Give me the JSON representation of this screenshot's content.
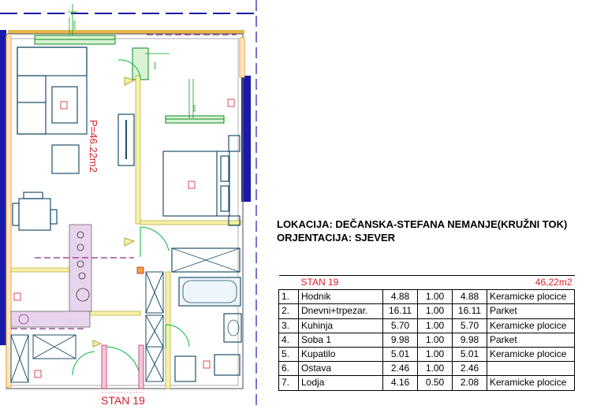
{
  "floor_plan": {
    "area_label": "P=46.22m2",
    "apartment_label": "STAN 19",
    "colors": {
      "wall": "#1a1aa8",
      "window_green": "#0a8a1a",
      "dims": "#0a9e1a",
      "door_swing": "#00b83a",
      "furniture": "#1e4f6a",
      "annotation_red": "#d4202a",
      "balcony_orange": "#f2a23a"
    }
  },
  "info": {
    "location": "LOKACIJA: DEČANSKA-STEFANA NEMANJE(KRUŽNI TOK)",
    "orientation": "ORJENTACIJA: SJEVER"
  },
  "room_table": {
    "title": "STAN 19",
    "total": "46,22m2",
    "rows": [
      {
        "no": "1.",
        "name": "Hodnik",
        "area": "4.88",
        "coef": "1.00",
        "net": "4.88",
        "floor": "Keramicke plocice"
      },
      {
        "no": "2.",
        "name": "Dnevni+trpezar.",
        "area": "16.11",
        "coef": "1.00",
        "net": "16.11",
        "floor": "Parket"
      },
      {
        "no": "3.",
        "name": "Kuhinja",
        "area": "5.70",
        "coef": "1.00",
        "net": "5.70",
        "floor": "Keramicke plocice"
      },
      {
        "no": "4.",
        "name": "Soba 1",
        "area": "9.98",
        "coef": "1.00",
        "net": "9.98",
        "floor": "Parket"
      },
      {
        "no": "5.",
        "name": "Kupatilo",
        "area": "5.01",
        "coef": "1.00",
        "net": "5.01",
        "floor": "Keramicke plocice"
      },
      {
        "no": "6.",
        "name": "Ostava",
        "area": "2.46",
        "coef": "1.00",
        "net": "2.46",
        "floor": ""
      },
      {
        "no": "7.",
        "name": "Lodja",
        "area": "4.16",
        "coef": "0.50",
        "net": "2.08",
        "floor": "Keramicke plocice"
      }
    ]
  }
}
